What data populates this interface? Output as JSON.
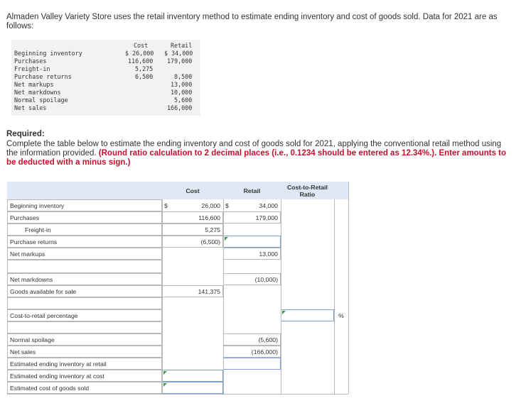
{
  "intro": "Almaden Valley Variety Store uses the retail inventory method to estimate ending inventory and cost of goods sold. Data for 2021 are as follows:",
  "given": {
    "headers": {
      "cost": "Cost",
      "retail": "Retail"
    },
    "rows": [
      {
        "label": "Beginning inventory",
        "cost": "$ 26,000",
        "retail": "$ 34,000"
      },
      {
        "label": "Purchases",
        "cost": "116,600",
        "retail": "179,000"
      },
      {
        "label": "Freight-in",
        "cost": "5,275",
        "retail": ""
      },
      {
        "label": "Purchase returns",
        "cost": "6,500",
        "retail": "8,500"
      },
      {
        "label": "Net markups",
        "cost": "",
        "retail": "13,000"
      },
      {
        "label": "Net markdowns",
        "cost": "",
        "retail": "10,000"
      },
      {
        "label": "Normal spoilage",
        "cost": "",
        "retail": "5,600"
      },
      {
        "label": "Net sales",
        "cost": "",
        "retail": "166,000"
      }
    ]
  },
  "required": {
    "title": "Required:",
    "text": "Complete the table below to estimate the ending inventory and cost of goods sold for 2021, applying the conventional retail method using the information provided.",
    "note": "(Round ratio calculation to 2 decimal places (i.e., 0.1234 should be entered as 12.34%.). Enter amounts to be deducted with a minus sign.)"
  },
  "table": {
    "headers": {
      "cost": "Cost",
      "retail": "Retail",
      "ratio": "Cost-to-Retail Ratio"
    },
    "currency": "$",
    "percent_sign": "%",
    "rows": {
      "beginning_inventory": {
        "label": "Beginning inventory",
        "cost": "26,000",
        "retail": "34,000"
      },
      "purchases": {
        "label": "Purchases",
        "cost": "116,600",
        "retail": "179,000"
      },
      "freight_in": {
        "label": "Freight-in",
        "cost": "5,275"
      },
      "purchase_returns": {
        "label": "Purchase returns",
        "cost": "(6,500)",
        "retail": ""
      },
      "net_markups": {
        "label": "Net markups",
        "retail": "13,000"
      },
      "net_markdowns": {
        "label": "Net markdowns",
        "retail": "(10,000)"
      },
      "goods_available": {
        "label": "Goods available for sale",
        "cost": "141,375"
      },
      "cost_to_retail": {
        "label": "Cost-to-retail percentage",
        "ratio": ""
      },
      "normal_spoilage": {
        "label": "Normal spoilage",
        "retail": "(5,600)"
      },
      "net_sales": {
        "label": "Net sales",
        "retail": "(166,000)"
      },
      "ending_retail": {
        "label": "Estimated ending inventory at retail",
        "retail": ""
      },
      "ending_cost": {
        "label": "Estimated ending inventory at cost",
        "cost": ""
      },
      "cogs": {
        "label": "Estimated cost of goods sold",
        "cost": ""
      }
    }
  }
}
